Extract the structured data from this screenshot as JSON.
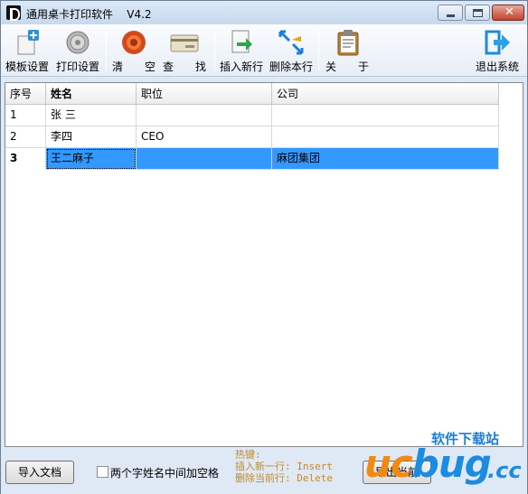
{
  "window": {
    "title": "通用桌卡打印软件    V4.2"
  },
  "toolbar": {
    "template_settings": "模板设置",
    "print_settings": "打印设置",
    "clear_a": "清",
    "clear_b": "空",
    "find_a": "查",
    "find_b": "找",
    "insert_row": "插入新行",
    "delete_row": "删除本行",
    "about_a": "关",
    "about_b": "于",
    "exit_system": "退出系统"
  },
  "table": {
    "headers": [
      "序号",
      "姓名",
      "职位",
      "公司"
    ],
    "rows": [
      {
        "idx": "1",
        "name": "张 三",
        "position": "",
        "company": ""
      },
      {
        "idx": "2",
        "name": "李四",
        "position": "CEO",
        "company": ""
      },
      {
        "idx": "3",
        "name": "王二麻子",
        "position": "",
        "company": "麻团集团"
      }
    ],
    "selected_row": 3
  },
  "footer": {
    "import_button": "导入文档",
    "checkbox_label": "两个字姓名中间加空格",
    "checkbox_checked": false,
    "hotkeys_title": "热键:",
    "hotkey_insert": "插入新一行: Insert",
    "hotkey_delete": "删除当前行: Delete",
    "export_button_partial": "导出当前"
  },
  "watermark": {
    "top": "软件下载站",
    "brand_a": "uc",
    "brand_b": "bug",
    "brand_c": ".cc"
  },
  "colors": {
    "selection": "#3399ff",
    "hotkey_text": "#c08a2a",
    "watermark_orange": "#f18a14",
    "watermark_blue": "#1d8ce0"
  }
}
